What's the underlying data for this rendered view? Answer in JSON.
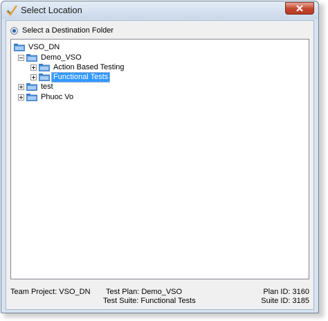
{
  "window": {
    "title": "Select Location"
  },
  "radio_label": "Select a Destination Folder",
  "tree": {
    "root": "VSO_DN",
    "project": "Demo_VSO",
    "children": [
      "Action Based Testing",
      "Functional Tests"
    ],
    "siblings": [
      "test",
      "Phuoc Vo"
    ]
  },
  "footer": {
    "team_project": "Team Project: VSO_DN",
    "test_plan": "Test Plan: Demo_VSO",
    "test_suite": "Test Suite: Functional Tests",
    "plan_id": "Plan ID: 3160",
    "suite_id": "Suite ID: 3185"
  },
  "colors": {
    "selection": "#3399ff",
    "close": "#c4452c",
    "folder": "#4a8fd6"
  },
  "icons": {
    "app": "checkmark-icon",
    "close": "close-icon",
    "folder": "folder-icon"
  }
}
